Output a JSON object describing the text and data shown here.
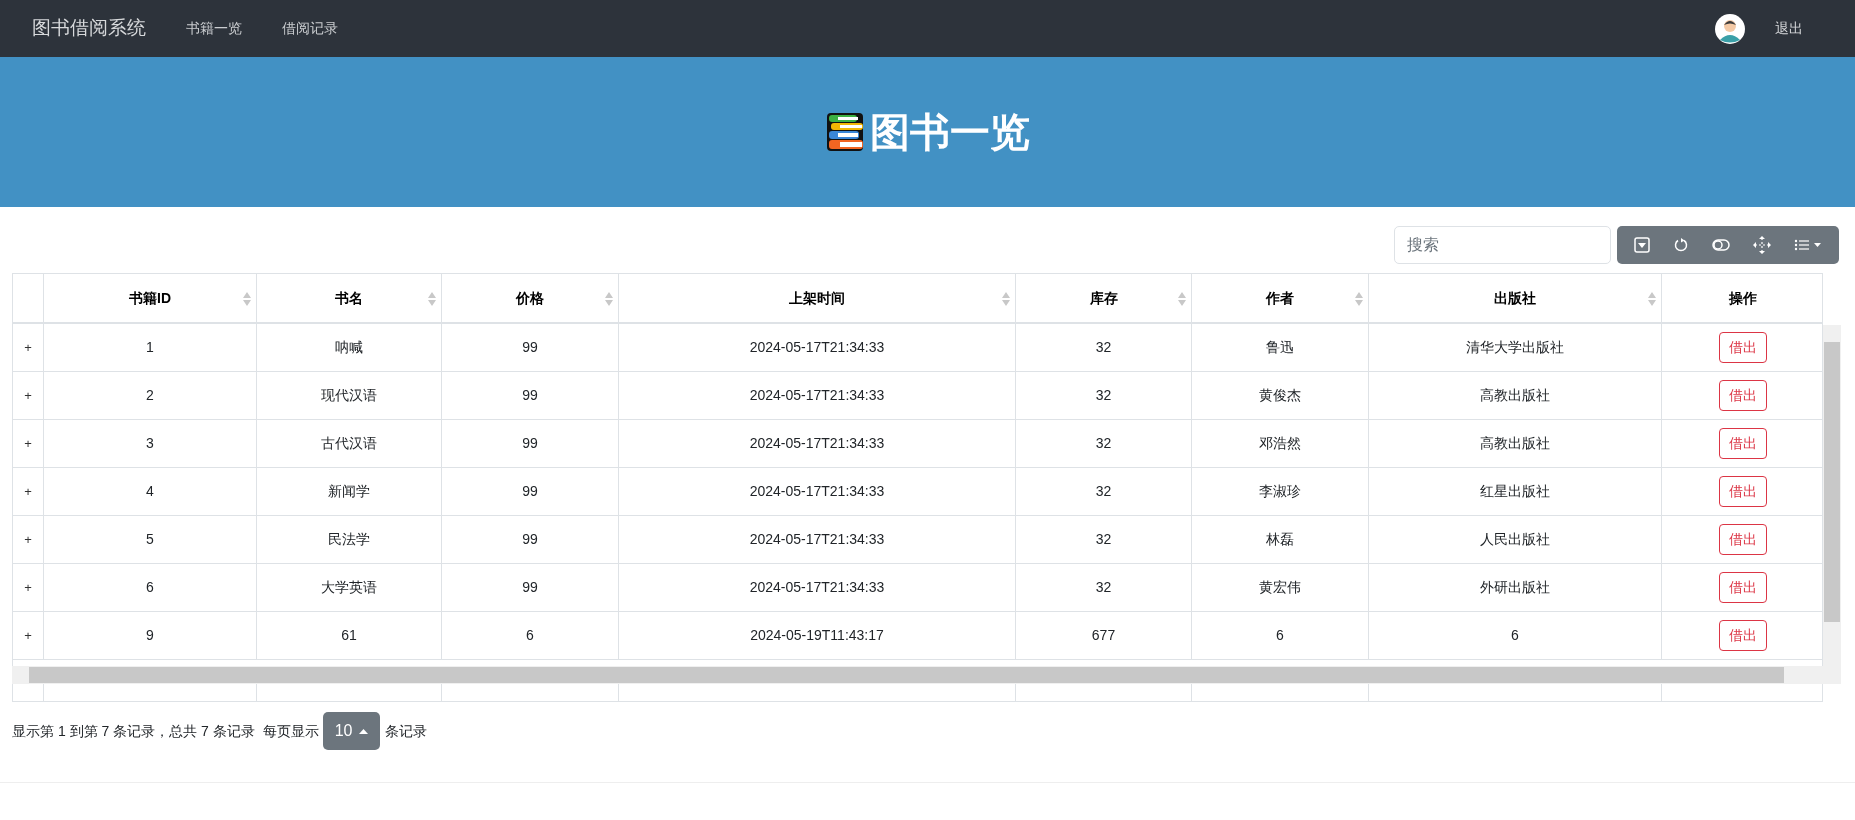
{
  "navbar": {
    "brand": "图书借阅系统",
    "links": [
      {
        "label": "书籍一览",
        "selected": false
      },
      {
        "label": "借阅记录",
        "selected": false
      }
    ],
    "logout": "退出"
  },
  "banner": {
    "title": "图书一览"
  },
  "search": {
    "placeholder": "搜索"
  },
  "table": {
    "columns": [
      {
        "label": "书籍ID",
        "sortable": true
      },
      {
        "label": "书名",
        "sortable": true
      },
      {
        "label": "价格",
        "sortable": true
      },
      {
        "label": "上架时间",
        "sortable": true
      },
      {
        "label": "库存",
        "sortable": true
      },
      {
        "label": "作者",
        "sortable": true
      },
      {
        "label": "出版社",
        "sortable": true
      },
      {
        "label": "操作",
        "sortable": false
      }
    ],
    "rows": [
      {
        "expand": "+",
        "cells": [
          "1",
          "呐喊",
          "99",
          "2024-05-17T21:34:33",
          "32",
          "鲁迅",
          "清华大学出版社"
        ],
        "action": "借出"
      },
      {
        "expand": "+",
        "cells": [
          "2",
          "现代汉语",
          "99",
          "2024-05-17T21:34:33",
          "32",
          "黄俊杰",
          "高教出版社"
        ],
        "action": "借出"
      },
      {
        "expand": "+",
        "cells": [
          "3",
          "古代汉语",
          "99",
          "2024-05-17T21:34:33",
          "32",
          "邓浩然",
          "高教出版社"
        ],
        "action": "借出"
      },
      {
        "expand": "+",
        "cells": [
          "4",
          "新闻学",
          "99",
          "2024-05-17T21:34:33",
          "32",
          "李淑珍",
          "红星出版社"
        ],
        "action": "借出"
      },
      {
        "expand": "+",
        "cells": [
          "5",
          "民法学",
          "99",
          "2024-05-17T21:34:33",
          "32",
          "林磊",
          "人民出版社"
        ],
        "action": "借出"
      },
      {
        "expand": "+",
        "cells": [
          "6",
          "大学英语",
          "99",
          "2024-05-17T21:34:33",
          "32",
          "黄宏伟",
          "外研出版社"
        ],
        "action": "借出"
      },
      {
        "expand": "+",
        "cells": [
          "9",
          "61",
          "6",
          "2024-05-19T11:43:17",
          "677",
          "6",
          "6"
        ],
        "action": "借出"
      }
    ]
  },
  "pagination": {
    "summary": "显示第 1 到第 7 条记录，总共 7 条记录",
    "per_page_label": "每页显示",
    "page_size": "10",
    "suffix": "条记录"
  }
}
